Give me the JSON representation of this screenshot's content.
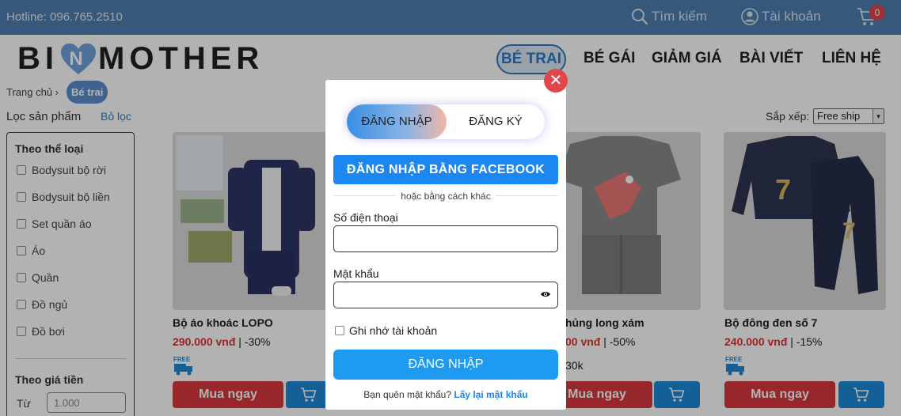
{
  "topbar": {
    "hotline": "Hotline: 096.765.2510",
    "search_label": "Tìm kiếm",
    "account_label": "Tài khoản",
    "cart_count": "0"
  },
  "logo": {
    "left": "BI",
    "right": "MOTHER",
    "heart_letter": "N"
  },
  "nav": [
    "BÉ TRAI",
    "BÉ GÁI",
    "GIẢM GIÁ",
    "BÀI VIẾT",
    "LIÊN HỆ"
  ],
  "breadcrumb": {
    "home": "Trang chủ ›",
    "current": "Bé trai"
  },
  "filter": {
    "title": "Lọc sản phẩm",
    "clear": "Bỏ lọc",
    "category_heading": "Theo thể loại",
    "categories": [
      "Bodysuit bộ rời",
      "Bodysuit bộ liền",
      "Set quần áo",
      "Áo",
      "Quần",
      "Đồ ngủ",
      "Đồ bơi"
    ],
    "price_heading": "Theo giá tiền",
    "price_from_label": "Từ",
    "price_from_placeholder": "1.000"
  },
  "sort": {
    "label": "Sắp xếp:",
    "selected": "Free ship"
  },
  "products": [
    {
      "name": "Bộ áo khoác LOPO",
      "price": "290.000 vnđ",
      "discount": "| -30%",
      "buy_label": "Mua ngay"
    },
    {
      "name": "hủng long xám",
      "price": "00 vnđ",
      "discount": "| -50%",
      "extra": "30k",
      "buy_label": "Mua ngay"
    },
    {
      "name": "Bộ đông đen số 7",
      "price": "240.000 vnđ",
      "discount": "| -15%",
      "buy_label": "Mua ngay"
    }
  ],
  "modal": {
    "tab_login": "ĐĂNG NHẬP",
    "tab_register": "ĐĂNG KÝ",
    "facebook_button": "ĐĂNG NHẬP BẰNG FACEBOOK",
    "or_text": "hoặc bằng cách khác",
    "phone_label": "Số điện thoại",
    "password_label": "Mật khẩu",
    "remember_label": "Ghi nhớ tài khoản",
    "login_button": "ĐĂNG NHẬP",
    "forgot_text": "Bạn quên mật khẩu?",
    "forgot_link": "Lấy lại mật khẩu",
    "close_symbol": "✕"
  },
  "colors": {
    "topbar": "#4d7eb0",
    "accent_blue": "#1d87f1",
    "buy_red": "#d9383d",
    "price_red": "#dd3333",
    "close_red": "#e0474c"
  }
}
